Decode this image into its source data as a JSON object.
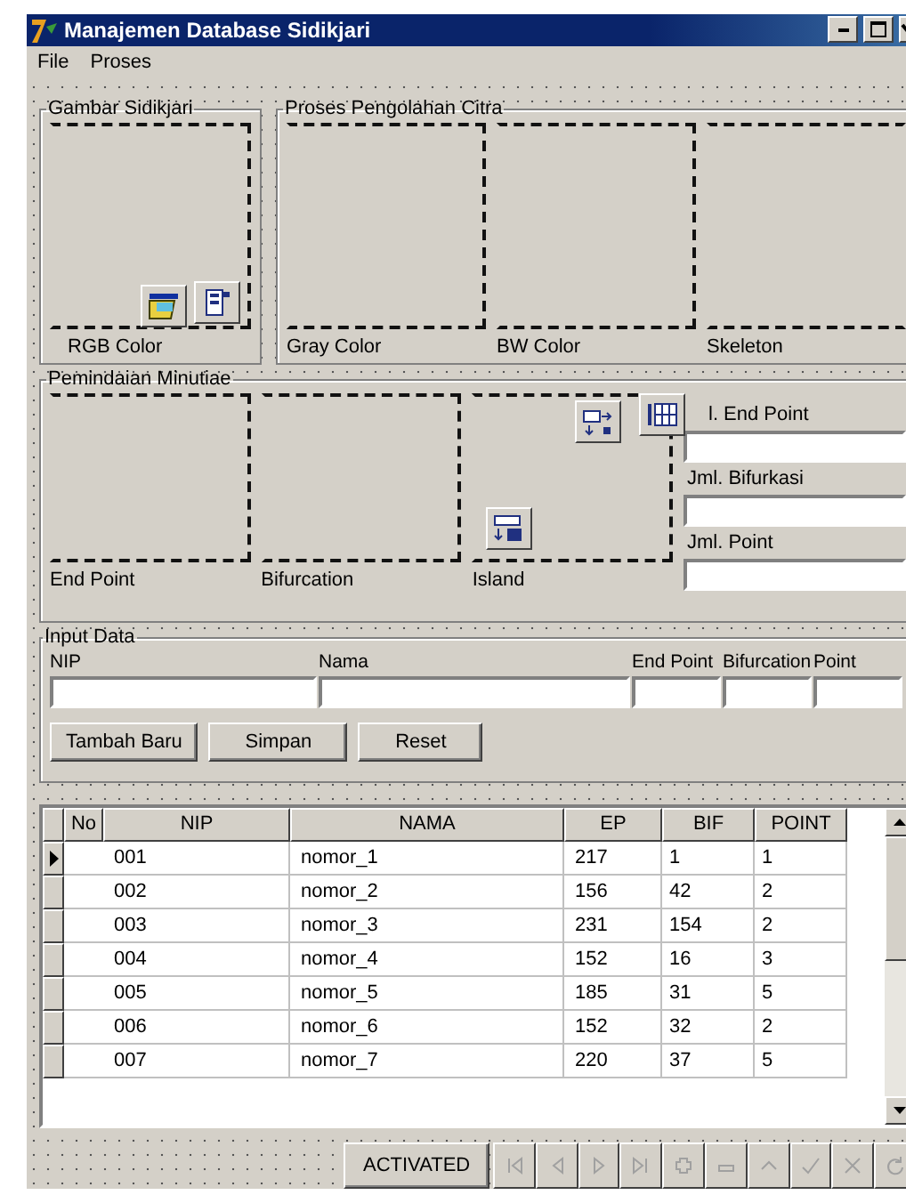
{
  "window": {
    "title": "Manajemen Database Sidikjari"
  },
  "menu": [
    {
      "label": "File"
    },
    {
      "label": "Proses"
    }
  ],
  "image_group": {
    "title": "Gambar Sidikjari",
    "caption": "RGB Color"
  },
  "process_group": {
    "title": "Proses Pengolahan Citra",
    "captions": [
      "Gray Color",
      "BW Color",
      "Skeleton"
    ]
  },
  "minutiae_group": {
    "title": "Pemindaian Minutiae",
    "captions": [
      "End Point",
      "Bifurcation",
      "Island"
    ],
    "stats": [
      {
        "label": "l. End Point"
      },
      {
        "label": "Jml. Bifurkasi"
      },
      {
        "label": "Jml. Point"
      }
    ]
  },
  "input_group": {
    "title": "Input Data",
    "fields": [
      {
        "label": "NIP"
      },
      {
        "label": "Nama"
      },
      {
        "label": "End Point"
      },
      {
        "label": "Bifurcation"
      },
      {
        "label": "Point"
      }
    ],
    "buttons": [
      "Tambah Baru",
      "Simpan",
      "Reset"
    ]
  },
  "table": {
    "columns": [
      "No",
      "NIP",
      "NAMA",
      "EP",
      "BIF",
      "POINT"
    ],
    "rows": [
      {
        "cells": [
          "001",
          "nomor_1",
          "217",
          "1",
          "1"
        ],
        "selected": true
      },
      {
        "cells": [
          "002",
          "nomor_2",
          "156",
          "42",
          "2"
        ],
        "selected": false
      },
      {
        "cells": [
          "003",
          "nomor_3",
          "231",
          "154",
          "2"
        ],
        "selected": false
      },
      {
        "cells": [
          "004",
          "nomor_4",
          "152",
          "16",
          "3"
        ],
        "selected": false
      },
      {
        "cells": [
          "005",
          "nomor_5",
          "185",
          "31",
          "5"
        ],
        "selected": false
      },
      {
        "cells": [
          "006",
          "nomor_6",
          "152",
          "32",
          "2"
        ],
        "selected": false
      },
      {
        "cells": [
          "007",
          "nomor_7",
          "220",
          "37",
          "5"
        ],
        "selected": false
      }
    ]
  },
  "navigator": {
    "label": "ACTIVATED",
    "disabled": true
  }
}
